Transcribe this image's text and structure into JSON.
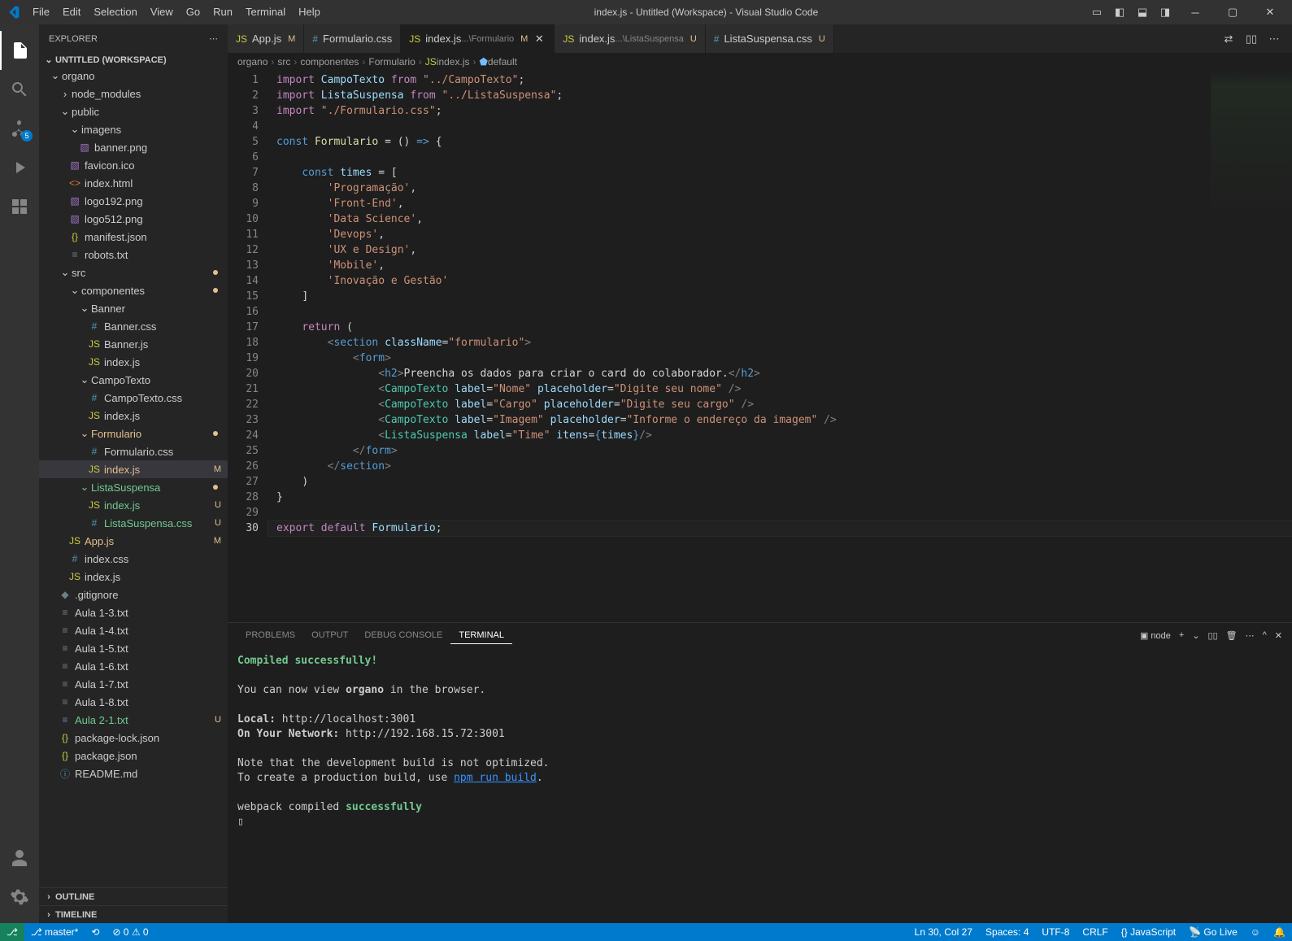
{
  "title": "index.js - Untitled (Workspace) - Visual Studio Code",
  "menu": [
    "File",
    "Edit",
    "Selection",
    "View",
    "Go",
    "Run",
    "Terminal",
    "Help"
  ],
  "sidebar": {
    "title": "EXPLORER",
    "workspace": "UNTITLED (WORKSPACE)",
    "outline": "OUTLINE",
    "timeline": "TIMELINE"
  },
  "tree": {
    "root": "organo",
    "items": [
      {
        "name": "node_modules",
        "type": "folder",
        "indent": 1,
        "collapsed": true
      },
      {
        "name": "public",
        "type": "folder",
        "indent": 1
      },
      {
        "name": "imagens",
        "type": "folder",
        "indent": 2
      },
      {
        "name": "banner.png",
        "type": "img",
        "indent": 3
      },
      {
        "name": "favicon.ico",
        "type": "img",
        "indent": 2,
        "star": true
      },
      {
        "name": "index.html",
        "type": "html",
        "indent": 2
      },
      {
        "name": "logo192.png",
        "type": "img",
        "indent": 2
      },
      {
        "name": "logo512.png",
        "type": "img",
        "indent": 2
      },
      {
        "name": "manifest.json",
        "type": "json",
        "indent": 2
      },
      {
        "name": "robots.txt",
        "type": "txt",
        "indent": 2
      },
      {
        "name": "src",
        "type": "folder",
        "indent": 1,
        "dot": true
      },
      {
        "name": "componentes",
        "type": "folder",
        "indent": 2,
        "dot": true
      },
      {
        "name": "Banner",
        "type": "folder",
        "indent": 3
      },
      {
        "name": "Banner.css",
        "type": "css",
        "indent": 4
      },
      {
        "name": "Banner.js",
        "type": "js",
        "indent": 4
      },
      {
        "name": "index.js",
        "type": "js",
        "indent": 4
      },
      {
        "name": "CampoTexto",
        "type": "folder",
        "indent": 3
      },
      {
        "name": "CampoTexto.css",
        "type": "css",
        "indent": 4
      },
      {
        "name": "index.js",
        "type": "js",
        "indent": 4
      },
      {
        "name": "Formulario",
        "type": "folder",
        "indent": 3,
        "dot": true,
        "mod": true
      },
      {
        "name": "Formulario.css",
        "type": "css",
        "indent": 4
      },
      {
        "name": "index.js",
        "type": "js",
        "indent": 4,
        "status": "M",
        "selected": true,
        "mod": true
      },
      {
        "name": "ListaSuspensa",
        "type": "folder",
        "indent": 3,
        "dot": true,
        "untracked": true
      },
      {
        "name": "index.js",
        "type": "js",
        "indent": 4,
        "status": "U",
        "untracked": true
      },
      {
        "name": "ListaSuspensa.css",
        "type": "css",
        "indent": 4,
        "status": "U",
        "untracked": true
      },
      {
        "name": "App.js",
        "type": "js",
        "indent": 2,
        "status": "M",
        "mod": true
      },
      {
        "name": "index.css",
        "type": "css",
        "indent": 2
      },
      {
        "name": "index.js",
        "type": "js",
        "indent": 2
      },
      {
        "name": ".gitignore",
        "type": "git",
        "indent": 1
      },
      {
        "name": "Aula 1-3.txt",
        "type": "txt",
        "indent": 1
      },
      {
        "name": "Aula 1-4.txt",
        "type": "txt",
        "indent": 1
      },
      {
        "name": "Aula 1-5.txt",
        "type": "txt",
        "indent": 1
      },
      {
        "name": "Aula 1-6.txt",
        "type": "txt",
        "indent": 1
      },
      {
        "name": "Aula 1-7.txt",
        "type": "txt",
        "indent": 1
      },
      {
        "name": "Aula 1-8.txt",
        "type": "txt",
        "indent": 1
      },
      {
        "name": "Aula 2-1.txt",
        "type": "txt",
        "indent": 1,
        "status": "U",
        "untracked": true
      },
      {
        "name": "package-lock.json",
        "type": "json",
        "indent": 1
      },
      {
        "name": "package.json",
        "type": "json",
        "indent": 1
      },
      {
        "name": "README.md",
        "type": "info",
        "indent": 1
      }
    ]
  },
  "tabs": [
    {
      "label": "App.js",
      "icon": "js",
      "status": "M"
    },
    {
      "label": "Formulario.css",
      "icon": "css"
    },
    {
      "label": "index.js",
      "sub": "...\\Formulario",
      "icon": "js",
      "status": "M",
      "active": true,
      "close": true
    },
    {
      "label": "index.js",
      "sub": "...\\ListaSuspensa",
      "icon": "js",
      "status": "U"
    },
    {
      "label": "ListaSuspensa.css",
      "icon": "css",
      "status": "U"
    }
  ],
  "breadcrumbs": [
    "organo",
    "src",
    "componentes",
    "Formulario",
    "index.js",
    "default"
  ],
  "code": {
    "lines": 30,
    "times": [
      "Programação",
      "Front-End",
      "Data Science",
      "Devops",
      "UX e Design",
      "Mobile",
      "Inovação e Gestão"
    ],
    "h2text": "Preencha os dados para criar o card do colaborador.",
    "campos": [
      {
        "label": "Nome",
        "placeholder": "Digite seu nome"
      },
      {
        "label": "Cargo",
        "placeholder": "Digite seu cargo"
      },
      {
        "label": "Imagem",
        "placeholder": "Informe o endereço da imagem"
      }
    ]
  },
  "panel": {
    "tabs": [
      "PROBLEMS",
      "OUTPUT",
      "DEBUG CONSOLE",
      "TERMINAL"
    ],
    "active": 3,
    "selector": "node",
    "lines": {
      "compiled": "Compiled successfully!",
      "view": "You can now view ",
      "organo": "organo",
      "browser": " in the browser.",
      "local_label": "Local:",
      "local_url": "http://localhost:3001",
      "net_label": "On Your Network:",
      "net_url": "http://192.168.15.72:3001",
      "note": "Note that the development build is not optimized.",
      "prod": "To create a production build, use ",
      "npm": "npm run build",
      "webpack": "webpack compiled ",
      "success": "successfully"
    }
  },
  "status": {
    "remote": "⎇",
    "branch": "master*",
    "sync": "⟲",
    "errors": "0",
    "warnings": "0",
    "lncol": "Ln 30, Col 27",
    "spaces": "Spaces: 4",
    "encoding": "UTF-8",
    "eol": "CRLF",
    "lang": "JavaScript",
    "golive": "Go Live",
    "feedback": "☺"
  },
  "scm_badge": "5"
}
